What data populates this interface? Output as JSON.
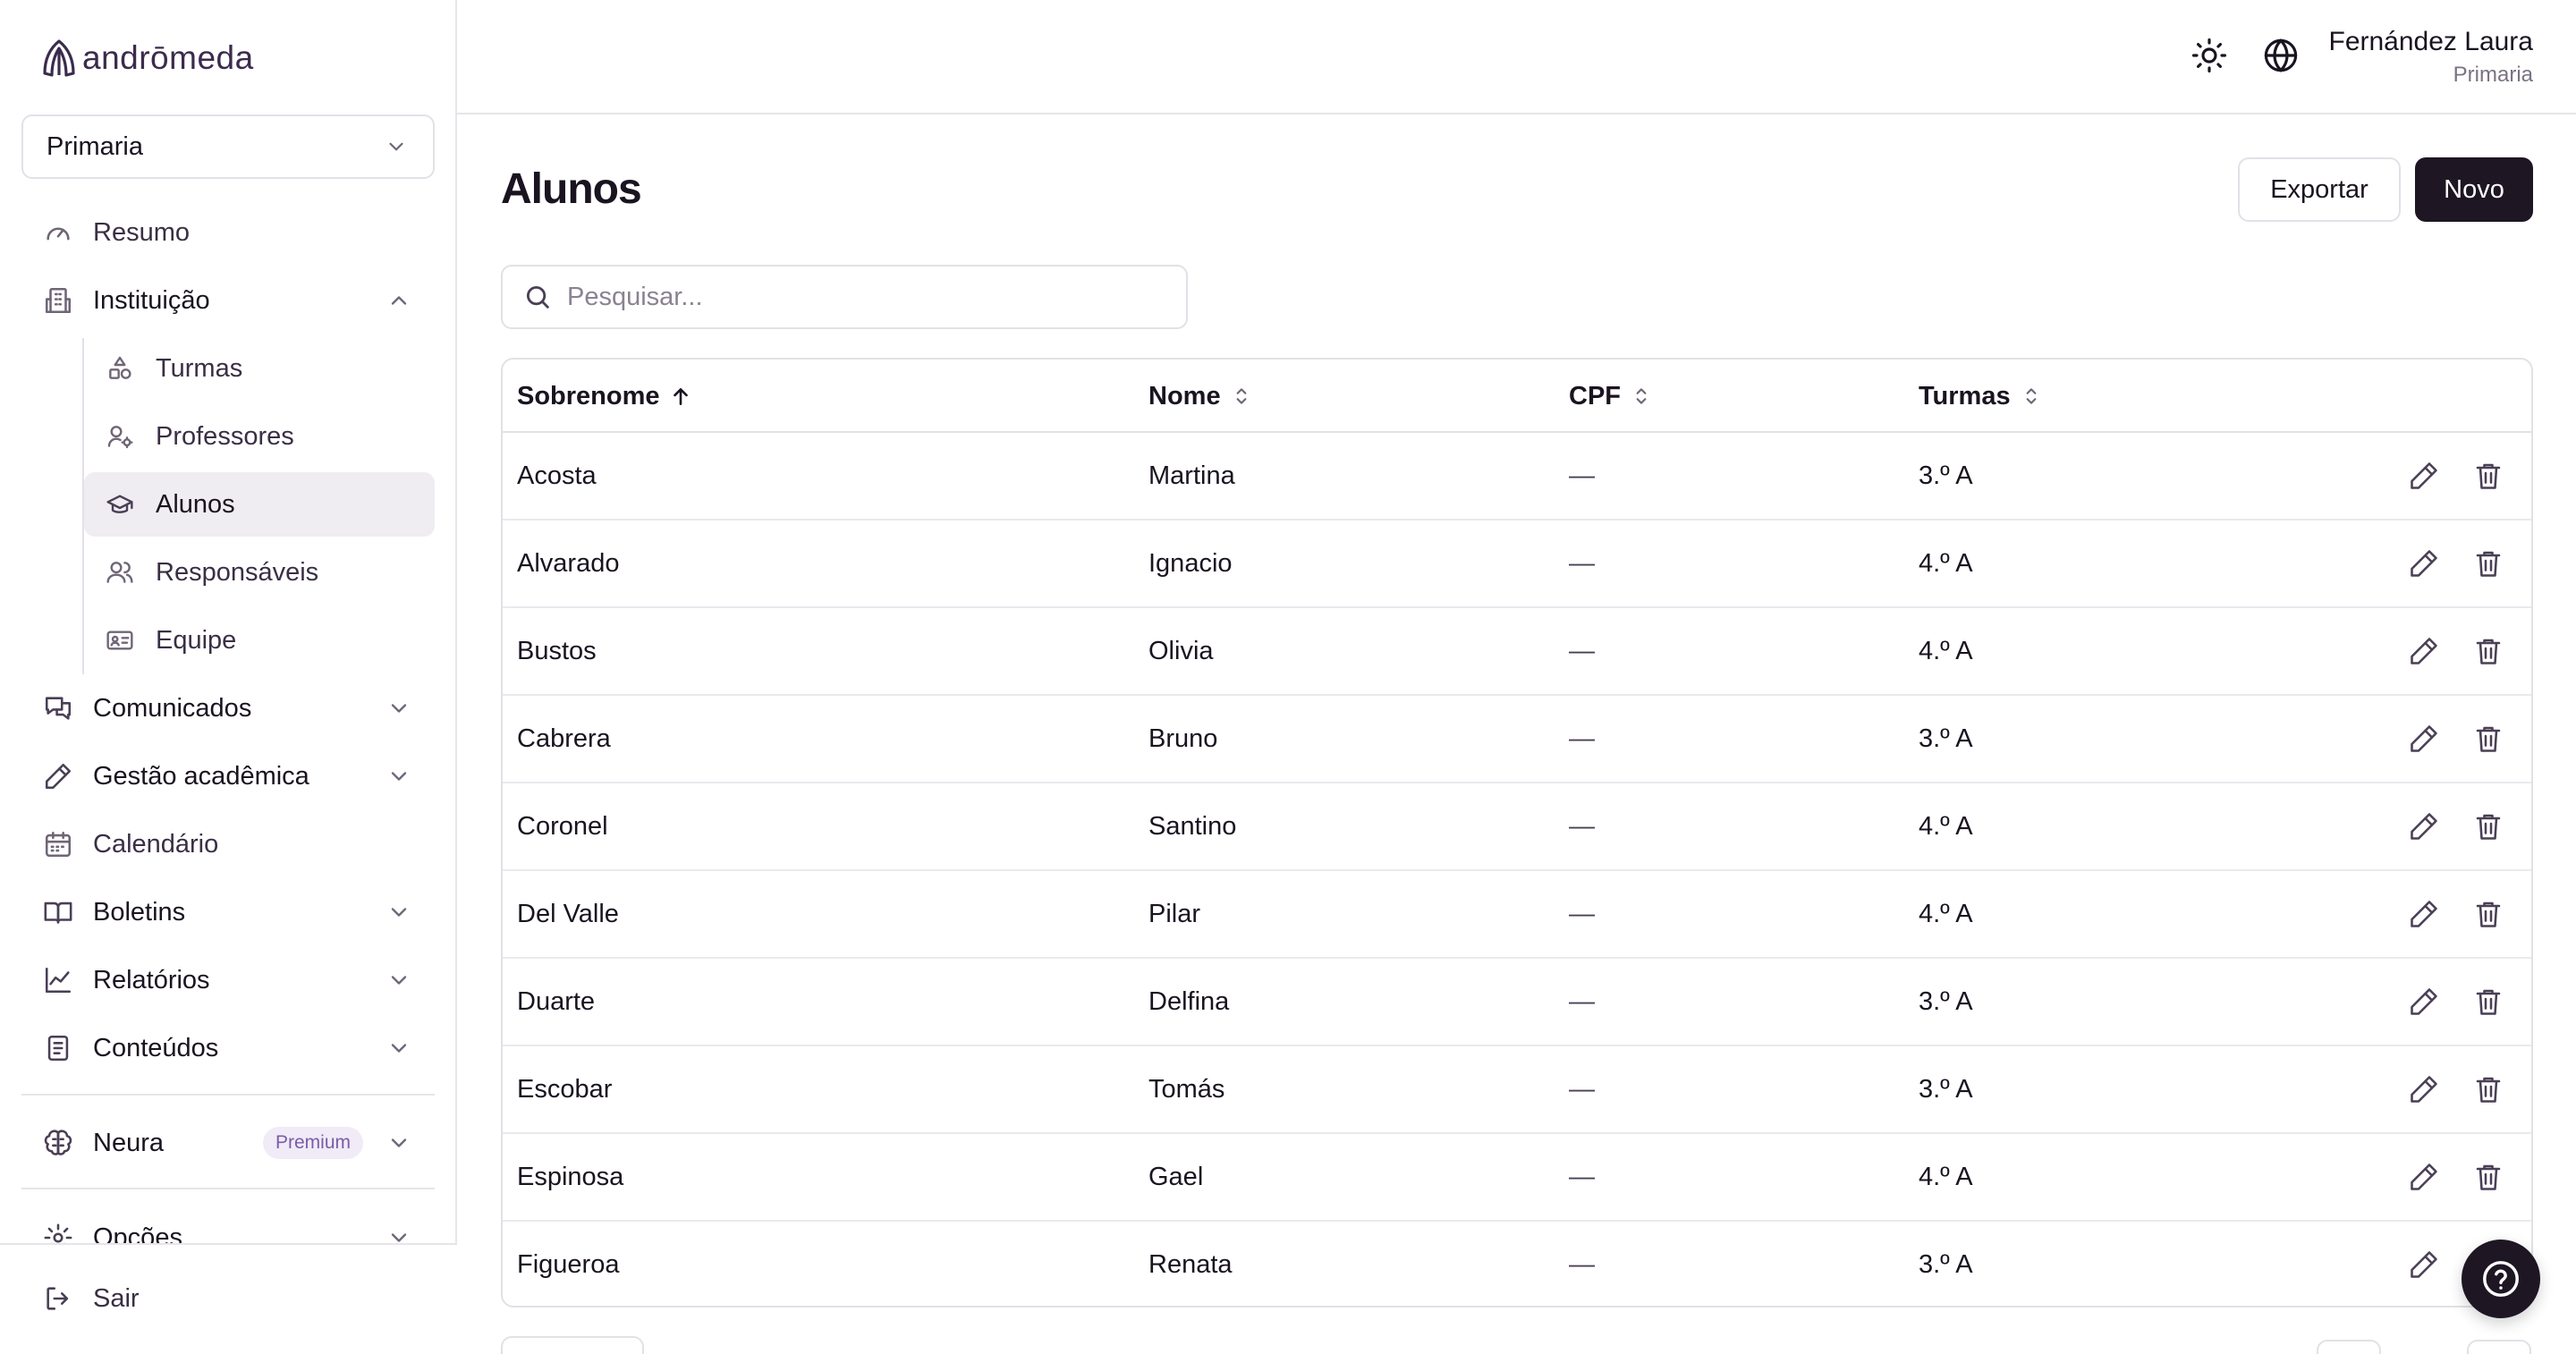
{
  "brand": {
    "name": "andrōmeda"
  },
  "scope": {
    "value": "Primaria"
  },
  "nav": {
    "resumo": "Resumo",
    "instituicao": "Instituição",
    "sub": {
      "turmas": "Turmas",
      "professores": "Professores",
      "alunos": "Alunos",
      "responsaveis": "Responsáveis",
      "equipe": "Equipe"
    },
    "comunicados": "Comunicados",
    "gestao": "Gestão acadêmica",
    "calendario": "Calendário",
    "boletins": "Boletins",
    "relatorios": "Relatórios",
    "conteudos": "Conteúdos",
    "neura": "Neura",
    "premium_badge": "Premium",
    "opcoes": "Opções",
    "sair": "Sair"
  },
  "user": {
    "name": "Fernández Laura",
    "role": "Primaria"
  },
  "page": {
    "title": "Alunos",
    "export_label": "Exportar",
    "new_label": "Novo",
    "search_placeholder": "Pesquisar..."
  },
  "table": {
    "columns": {
      "sobrenome": "Sobrenome",
      "nome": "Nome",
      "cpf": "CPF",
      "turmas": "Turmas"
    },
    "sort": {
      "column": "sobrenome",
      "direction": "asc"
    },
    "rows": [
      {
        "sobrenome": "Acosta",
        "nome": "Martina",
        "cpf": "—",
        "turmas": "3.º A"
      },
      {
        "sobrenome": "Alvarado",
        "nome": "Ignacio",
        "cpf": "—",
        "turmas": "4.º A"
      },
      {
        "sobrenome": "Bustos",
        "nome": "Olivia",
        "cpf": "—",
        "turmas": "4.º A"
      },
      {
        "sobrenome": "Cabrera",
        "nome": "Bruno",
        "cpf": "—",
        "turmas": "3.º A"
      },
      {
        "sobrenome": "Coronel",
        "nome": "Santino",
        "cpf": "—",
        "turmas": "4.º A"
      },
      {
        "sobrenome": "Del Valle",
        "nome": "Pilar",
        "cpf": "—",
        "turmas": "4.º A"
      },
      {
        "sobrenome": "Duarte",
        "nome": "Delfina",
        "cpf": "—",
        "turmas": "3.º A"
      },
      {
        "sobrenome": "Escobar",
        "nome": "Tomás",
        "cpf": "—",
        "turmas": "3.º A"
      },
      {
        "sobrenome": "Espinosa",
        "nome": "Gael",
        "cpf": "—",
        "turmas": "4.º A"
      },
      {
        "sobrenome": "Figueroa",
        "nome": "Renata",
        "cpf": "—",
        "turmas": "3.º A"
      }
    ]
  },
  "colors": {
    "primary": "#1e1623",
    "active_bg": "#efedf1",
    "border": "#e3e0e7",
    "premium_text": "#7a5ca8"
  },
  "icons": {
    "brand": "andromeda-logo-icon",
    "theme": "sun-icon",
    "language": "globe-icon",
    "help": "help-circle-icon",
    "search": "search-icon",
    "edit": "pencil-icon",
    "delete": "trash-icon"
  }
}
